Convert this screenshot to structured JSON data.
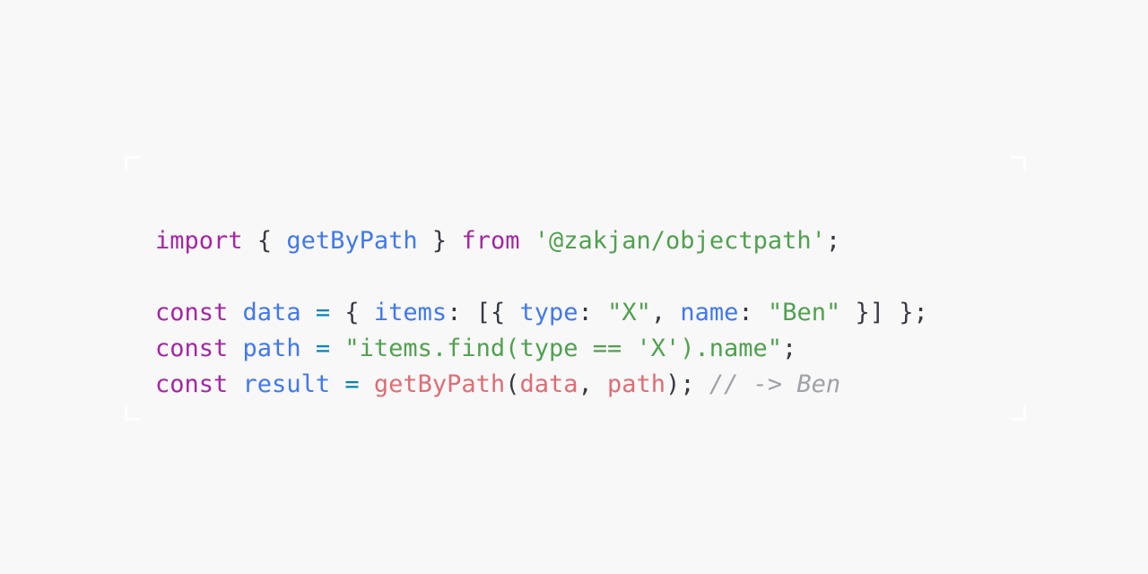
{
  "snippet": {
    "language": "javascript",
    "background_color": "#f8f8f8",
    "colors": {
      "keyword": "#a626a4",
      "entity": "#4078f2",
      "property": "#4078f2",
      "variable": "#4078f2",
      "string": "#50a14f",
      "function": "#e06c75",
      "parameter": "#e06c75",
      "operator": "#0184bc",
      "punctuation": "#383a42",
      "comment": "#a0a1a7",
      "frame": "#ffffff"
    },
    "plain_text": "import { getByPath } from '@zakjan/objectpath';\n\nconst data = { items: [{ type: \"X\", name: \"Ben\" }] };\nconst path = \"items.find(type == 'X').name\";\nconst result = getByPath(data, path); // -> Ben",
    "lines": [
      {
        "id": "line-import",
        "tokens": [
          {
            "text": "import",
            "kind": "keyword"
          },
          {
            "text": " ",
            "kind": "punctuation"
          },
          {
            "text": "{",
            "kind": "punctuation"
          },
          {
            "text": " ",
            "kind": "punctuation"
          },
          {
            "text": "getByPath",
            "kind": "entity"
          },
          {
            "text": " ",
            "kind": "punctuation"
          },
          {
            "text": "}",
            "kind": "punctuation"
          },
          {
            "text": " ",
            "kind": "punctuation"
          },
          {
            "text": "from",
            "kind": "keyword"
          },
          {
            "text": " ",
            "kind": "punctuation"
          },
          {
            "text": "'@zakjan/objectpath'",
            "kind": "string"
          },
          {
            "text": ";",
            "kind": "punctuation"
          }
        ]
      },
      {
        "id": "line-blank",
        "tokens": []
      },
      {
        "id": "line-data",
        "tokens": [
          {
            "text": "const",
            "kind": "keyword"
          },
          {
            "text": " ",
            "kind": "punctuation"
          },
          {
            "text": "data",
            "kind": "variable"
          },
          {
            "text": " ",
            "kind": "punctuation"
          },
          {
            "text": "=",
            "kind": "operator"
          },
          {
            "text": " ",
            "kind": "punctuation"
          },
          {
            "text": "{",
            "kind": "punctuation"
          },
          {
            "text": " ",
            "kind": "punctuation"
          },
          {
            "text": "items",
            "kind": "property"
          },
          {
            "text": ":",
            "kind": "punctuation"
          },
          {
            "text": " ",
            "kind": "punctuation"
          },
          {
            "text": "[{",
            "kind": "punctuation"
          },
          {
            "text": " ",
            "kind": "punctuation"
          },
          {
            "text": "type",
            "kind": "property"
          },
          {
            "text": ":",
            "kind": "punctuation"
          },
          {
            "text": " ",
            "kind": "punctuation"
          },
          {
            "text": "\"X\"",
            "kind": "string"
          },
          {
            "text": ",",
            "kind": "punctuation"
          },
          {
            "text": " ",
            "kind": "punctuation"
          },
          {
            "text": "name",
            "kind": "property"
          },
          {
            "text": ":",
            "kind": "punctuation"
          },
          {
            "text": " ",
            "kind": "punctuation"
          },
          {
            "text": "\"Ben\"",
            "kind": "string"
          },
          {
            "text": " ",
            "kind": "punctuation"
          },
          {
            "text": "}]",
            "kind": "punctuation"
          },
          {
            "text": " ",
            "kind": "punctuation"
          },
          {
            "text": "};",
            "kind": "punctuation"
          }
        ]
      },
      {
        "id": "line-path",
        "tokens": [
          {
            "text": "const",
            "kind": "keyword"
          },
          {
            "text": " ",
            "kind": "punctuation"
          },
          {
            "text": "path",
            "kind": "variable"
          },
          {
            "text": " ",
            "kind": "punctuation"
          },
          {
            "text": "=",
            "kind": "operator"
          },
          {
            "text": " ",
            "kind": "punctuation"
          },
          {
            "text": "\"items.find(type == 'X').name\"",
            "kind": "string"
          },
          {
            "text": ";",
            "kind": "punctuation"
          }
        ]
      },
      {
        "id": "line-result",
        "tokens": [
          {
            "text": "const",
            "kind": "keyword"
          },
          {
            "text": " ",
            "kind": "punctuation"
          },
          {
            "text": "result",
            "kind": "variable"
          },
          {
            "text": " ",
            "kind": "punctuation"
          },
          {
            "text": "=",
            "kind": "operator"
          },
          {
            "text": " ",
            "kind": "punctuation"
          },
          {
            "text": "getByPath",
            "kind": "function"
          },
          {
            "text": "(",
            "kind": "punctuation"
          },
          {
            "text": "data",
            "kind": "parameter"
          },
          {
            "text": ",",
            "kind": "punctuation"
          },
          {
            "text": " ",
            "kind": "punctuation"
          },
          {
            "text": "path",
            "kind": "parameter"
          },
          {
            "text": ");",
            "kind": "punctuation"
          },
          {
            "text": " ",
            "kind": "punctuation"
          },
          {
            "text": "// -> Ben",
            "kind": "comment"
          }
        ]
      }
    ]
  }
}
